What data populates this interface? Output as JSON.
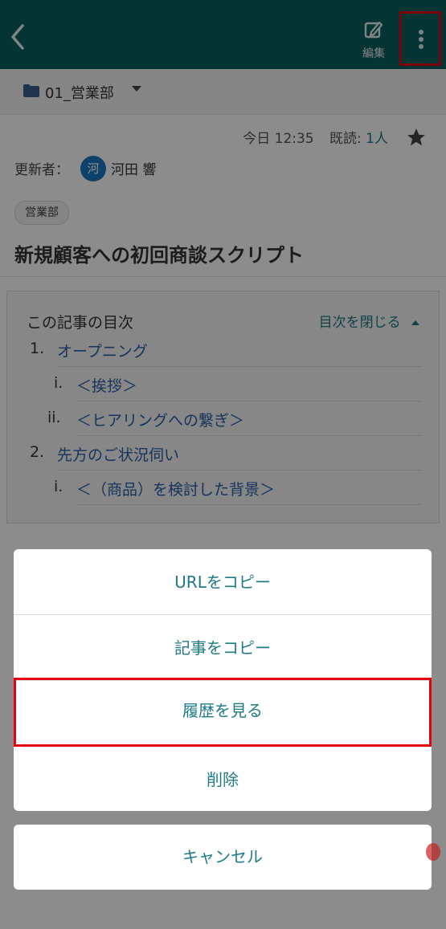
{
  "header": {
    "back_icon": "chevron-left-icon",
    "edit_icon": "edit-icon",
    "edit_label": "編集",
    "more_icon": "more-vertical-icon",
    "bg_color": "#08605f"
  },
  "breadcrumb": {
    "folder_icon": "folder-icon",
    "name": "01_営業部",
    "dropdown_icon": "caret-down-icon"
  },
  "meta": {
    "time": "今日 12:35",
    "read_label": "既読:",
    "read_count": "1人",
    "star_icon": "star-icon"
  },
  "author": {
    "label": "更新者：",
    "avatar_initial": "河",
    "name": "河田 響"
  },
  "tag": "営業部",
  "title": "新規顧客への初回商談スクリプト",
  "toc": {
    "title": "この記事の目次",
    "close_label": "目次を閉じる",
    "items": [
      {
        "num": "1.",
        "text": "オープニング"
      },
      {
        "num": "i.",
        "text": "＜挨拶＞"
      },
      {
        "num": "ii.",
        "text": "＜ヒアリングへの繋ぎ＞"
      },
      {
        "num": "2.",
        "text": "先方のご状況伺い"
      },
      {
        "num": "i.",
        "text": "＜（商品）を検討した背景＞"
      }
    ]
  },
  "action_sheet": {
    "items": [
      {
        "label": "URLをコピー"
      },
      {
        "label": "記事をコピー"
      },
      {
        "label": "履歴を見る"
      },
      {
        "label": "削除"
      }
    ],
    "cancel_label": "キャンセル"
  },
  "colors": {
    "accent": "#1e7a86",
    "highlight": "#e60012"
  }
}
